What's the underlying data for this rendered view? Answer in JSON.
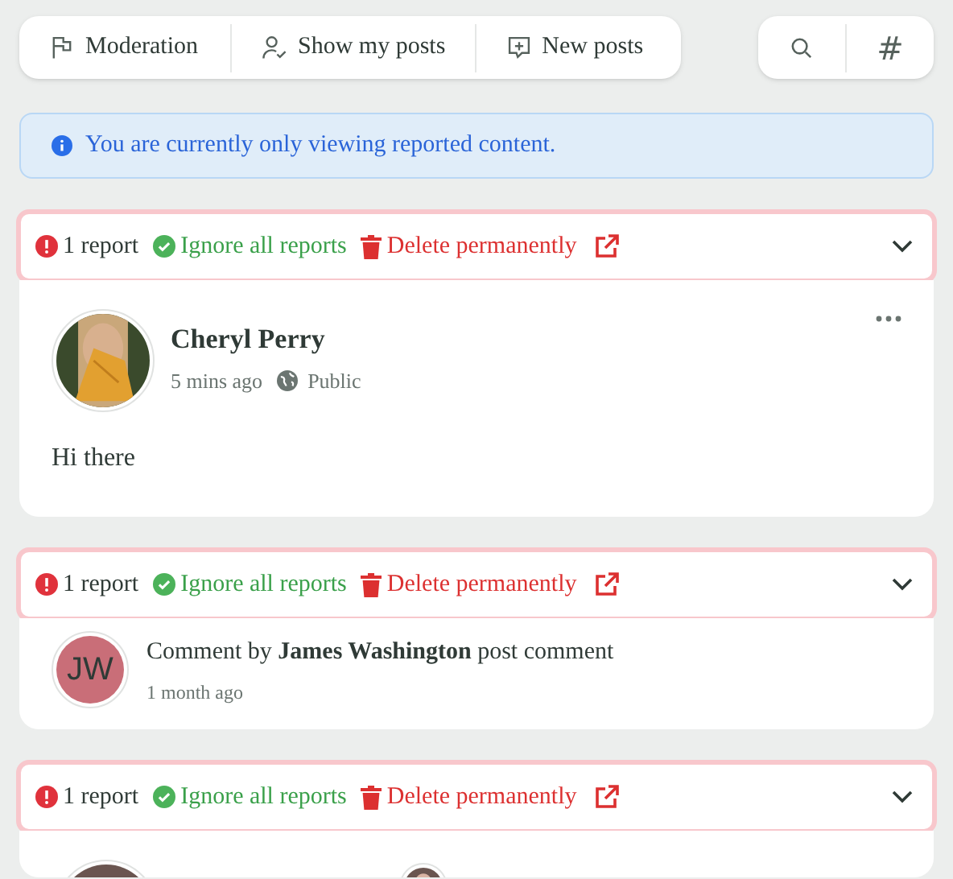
{
  "nav": {
    "items": [
      {
        "kind": "flag",
        "label": "Moderation"
      },
      {
        "kind": "user",
        "label": "Show my posts"
      },
      {
        "kind": "plus",
        "label": "New posts"
      }
    ],
    "tools": [
      {
        "kind": "search"
      },
      {
        "kind": "hash",
        "label": "#"
      }
    ]
  },
  "alert": {
    "text": "You are currently only viewing reported content."
  },
  "reports": [
    {
      "count": "1 report",
      "ignore": "Ignore all reports",
      "delete": "Delete permanently",
      "content": {
        "kind": "post",
        "author": "Cheryl Perry",
        "time": "5 mins ago",
        "visibility": "Public",
        "body": "Hi there"
      }
    },
    {
      "count": "1 report",
      "ignore": "Ignore all reports",
      "delete": "Delete permanently",
      "content": {
        "kind": "comment",
        "initials": "JW",
        "color": "#c96e78",
        "text": "Comment by **James Washington** post comment",
        "time": "1 month ago"
      }
    },
    {
      "count": "1 report",
      "ignore": "Ignore all reports",
      "delete": "Delete permanently",
      "content": {
        "kind": "partial"
      }
    }
  ]
}
